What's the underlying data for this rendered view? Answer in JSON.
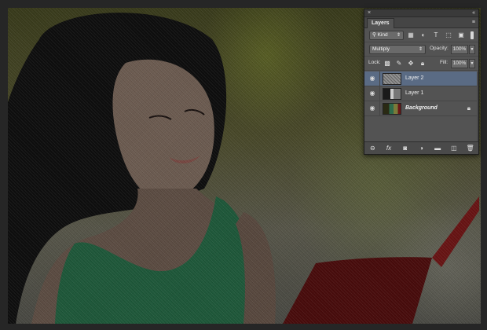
{
  "panel": {
    "title": "Layers",
    "close_glyph": "×",
    "collapse_glyph": "«",
    "menu_glyph": "≡"
  },
  "filter": {
    "kind_label": "Kind",
    "icons": [
      "image-icon",
      "adjustment-icon",
      "type-icon",
      "shape-icon",
      "smart-object-icon"
    ]
  },
  "blend": {
    "mode": "Multiply",
    "opacity_label": "Opacity:",
    "opacity_value": "100%"
  },
  "lock": {
    "label": "Lock:",
    "icons": [
      "lock-transparent-icon",
      "lock-image-icon",
      "lock-position-icon",
      "lock-all-icon"
    ],
    "fill_label": "Fill:",
    "fill_value": "100%"
  },
  "layers": [
    {
      "name": "Layer 2",
      "selected": true,
      "visible": true,
      "thumb": "noise",
      "locked": false,
      "italic": false
    },
    {
      "name": "Layer 1",
      "selected": false,
      "visible": true,
      "thumb": "bw",
      "locked": false,
      "italic": false
    },
    {
      "name": "Background",
      "selected": false,
      "visible": true,
      "thumb": "color",
      "locked": true,
      "italic": true
    }
  ],
  "footer_icons": [
    "link-icon",
    "fx-icon",
    "mask-icon",
    "adjustment-layer-icon",
    "group-folder-icon",
    "new-layer-icon",
    "trash-icon"
  ],
  "colors": {
    "panel_bg": "#535353",
    "selected_layer": "#5a6b84",
    "canvas_frame": "#262626"
  }
}
